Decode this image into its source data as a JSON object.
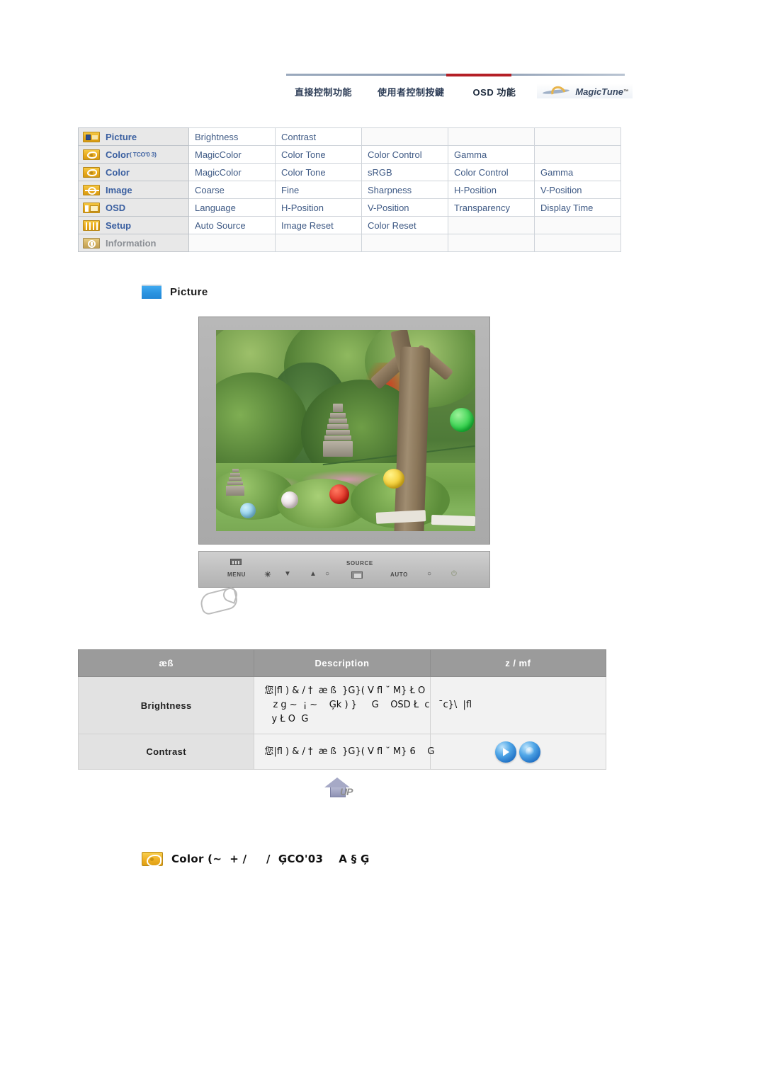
{
  "topnav": {
    "items": [
      {
        "label": "直接控制功能",
        "active": false
      },
      {
        "label": "使用者控制按鍵",
        "active": false
      },
      {
        "label": "OSD 功能",
        "active": true
      }
    ],
    "brand": "MagicTune",
    "brand_tm": "™",
    "accent_color": "#b41f26",
    "link_color": "#2c3c56"
  },
  "menu_table": {
    "rows": [
      {
        "icon": "picture-icon",
        "label": "Picture",
        "sup": "",
        "cells": [
          "Brightness",
          "Contrast",
          "",
          "",
          ""
        ]
      },
      {
        "icon": "color-icon",
        "label": "Color",
        "sup": "( TCO'0 3)",
        "cells": [
          "MagicColor",
          "Color Tone",
          "Color Control",
          "Gamma",
          ""
        ]
      },
      {
        "icon": "color-icon",
        "label": "Color",
        "sup": "",
        "cells": [
          "MagicColor",
          "Color Tone",
          "sRGB",
          "Color Control",
          "Gamma"
        ]
      },
      {
        "icon": "image-icon",
        "label": "Image",
        "sup": "",
        "cells": [
          "Coarse",
          "Fine",
          "Sharpness",
          "H-Position",
          "V-Position"
        ]
      },
      {
        "icon": "osd-icon",
        "label": "OSD",
        "sup": "",
        "cells": [
          "Language",
          "H-Position",
          "V-Position",
          "Transparency",
          "Display Time"
        ]
      },
      {
        "icon": "setup-icon",
        "label": "Setup",
        "sup": "",
        "cells": [
          "Auto Source",
          "Image Reset",
          "Color Reset",
          "",
          ""
        ]
      },
      {
        "icon": "information-icon",
        "label": "Information",
        "sup": "",
        "cells": [
          "",
          "",
          "",
          "",
          ""
        ]
      }
    ],
    "text_color": "#3f5a85",
    "header_bg": "#e8e8e8"
  },
  "section": {
    "title": "Picture",
    "swatch_color": "#2a93e0"
  },
  "monitor": {
    "buttons": {
      "menu": "MENU",
      "source": "SOURCE",
      "auto": "AUTO",
      "brightness_icon": "☀",
      "down_icon": "▼",
      "up_icon": "▲",
      "adjust_icon": "○",
      "enter_icon": "⊡",
      "exit_icon": "○",
      "power_icon": "⏻"
    },
    "screen_caption": "",
    "bezel_color": "#b0b0b0"
  },
  "desc_table": {
    "headers": {
      "name": "æß",
      "description": "Description",
      "control": "z  / mf"
    },
    "rows": [
      {
        "name": "Brightness",
        "lines": [
          "您|fl ) & / †  æ ß  }G}( V fl ˘ M} Ł O",
          " z g ~  ¡ ~    Ģk ) }     G    OSD Ł  c   ¯c}\\  |fl",
          " y Ł O  G"
        ],
        "controls": []
      },
      {
        "name": "Contrast",
        "lines": [
          "您|fl ) & / †  æ ß  }G}( V fl ˘ M} 6    G"
        ],
        "controls": [
          "play-orb",
          "plain-orb"
        ]
      }
    ]
  },
  "up_button": {
    "label": "UP"
  },
  "color_section": {
    "text": "Color (~  + /     /  ĢCO'03    A § Ģ"
  }
}
